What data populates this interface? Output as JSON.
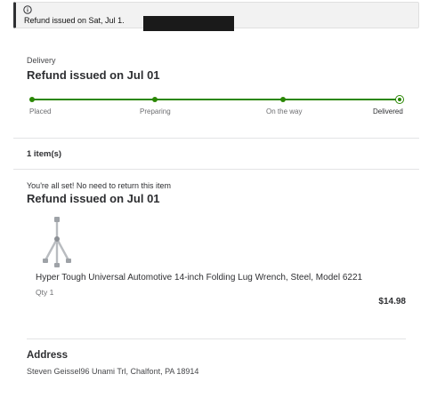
{
  "notice": {
    "icon": "info-icon",
    "text": "Refund issued on Sat, Jul 1."
  },
  "delivery": {
    "label": "Delivery",
    "heading": "Refund issued on Jul 01",
    "progress_color": "#2a8703",
    "steps": [
      {
        "label": "Placed"
      },
      {
        "label": "Preparing"
      },
      {
        "label": "On the way"
      },
      {
        "label": "Delivered",
        "current": true
      }
    ]
  },
  "items": {
    "count_label": "1 item(s)"
  },
  "return_info": {
    "message": "You're all set! No need to return this item",
    "heading": "Refund issued on Jul 01"
  },
  "product": {
    "image_icon": "lug-wrench-image",
    "name": "Hyper Tough Universal Automotive 14-inch Folding Lug Wrench, Steel, Model 6221",
    "qty": "Qty 1",
    "price": "$14.98"
  },
  "address": {
    "title": "Address",
    "text": "Steven Geissel96 Unami Trl, Chalfont, PA 18914"
  }
}
